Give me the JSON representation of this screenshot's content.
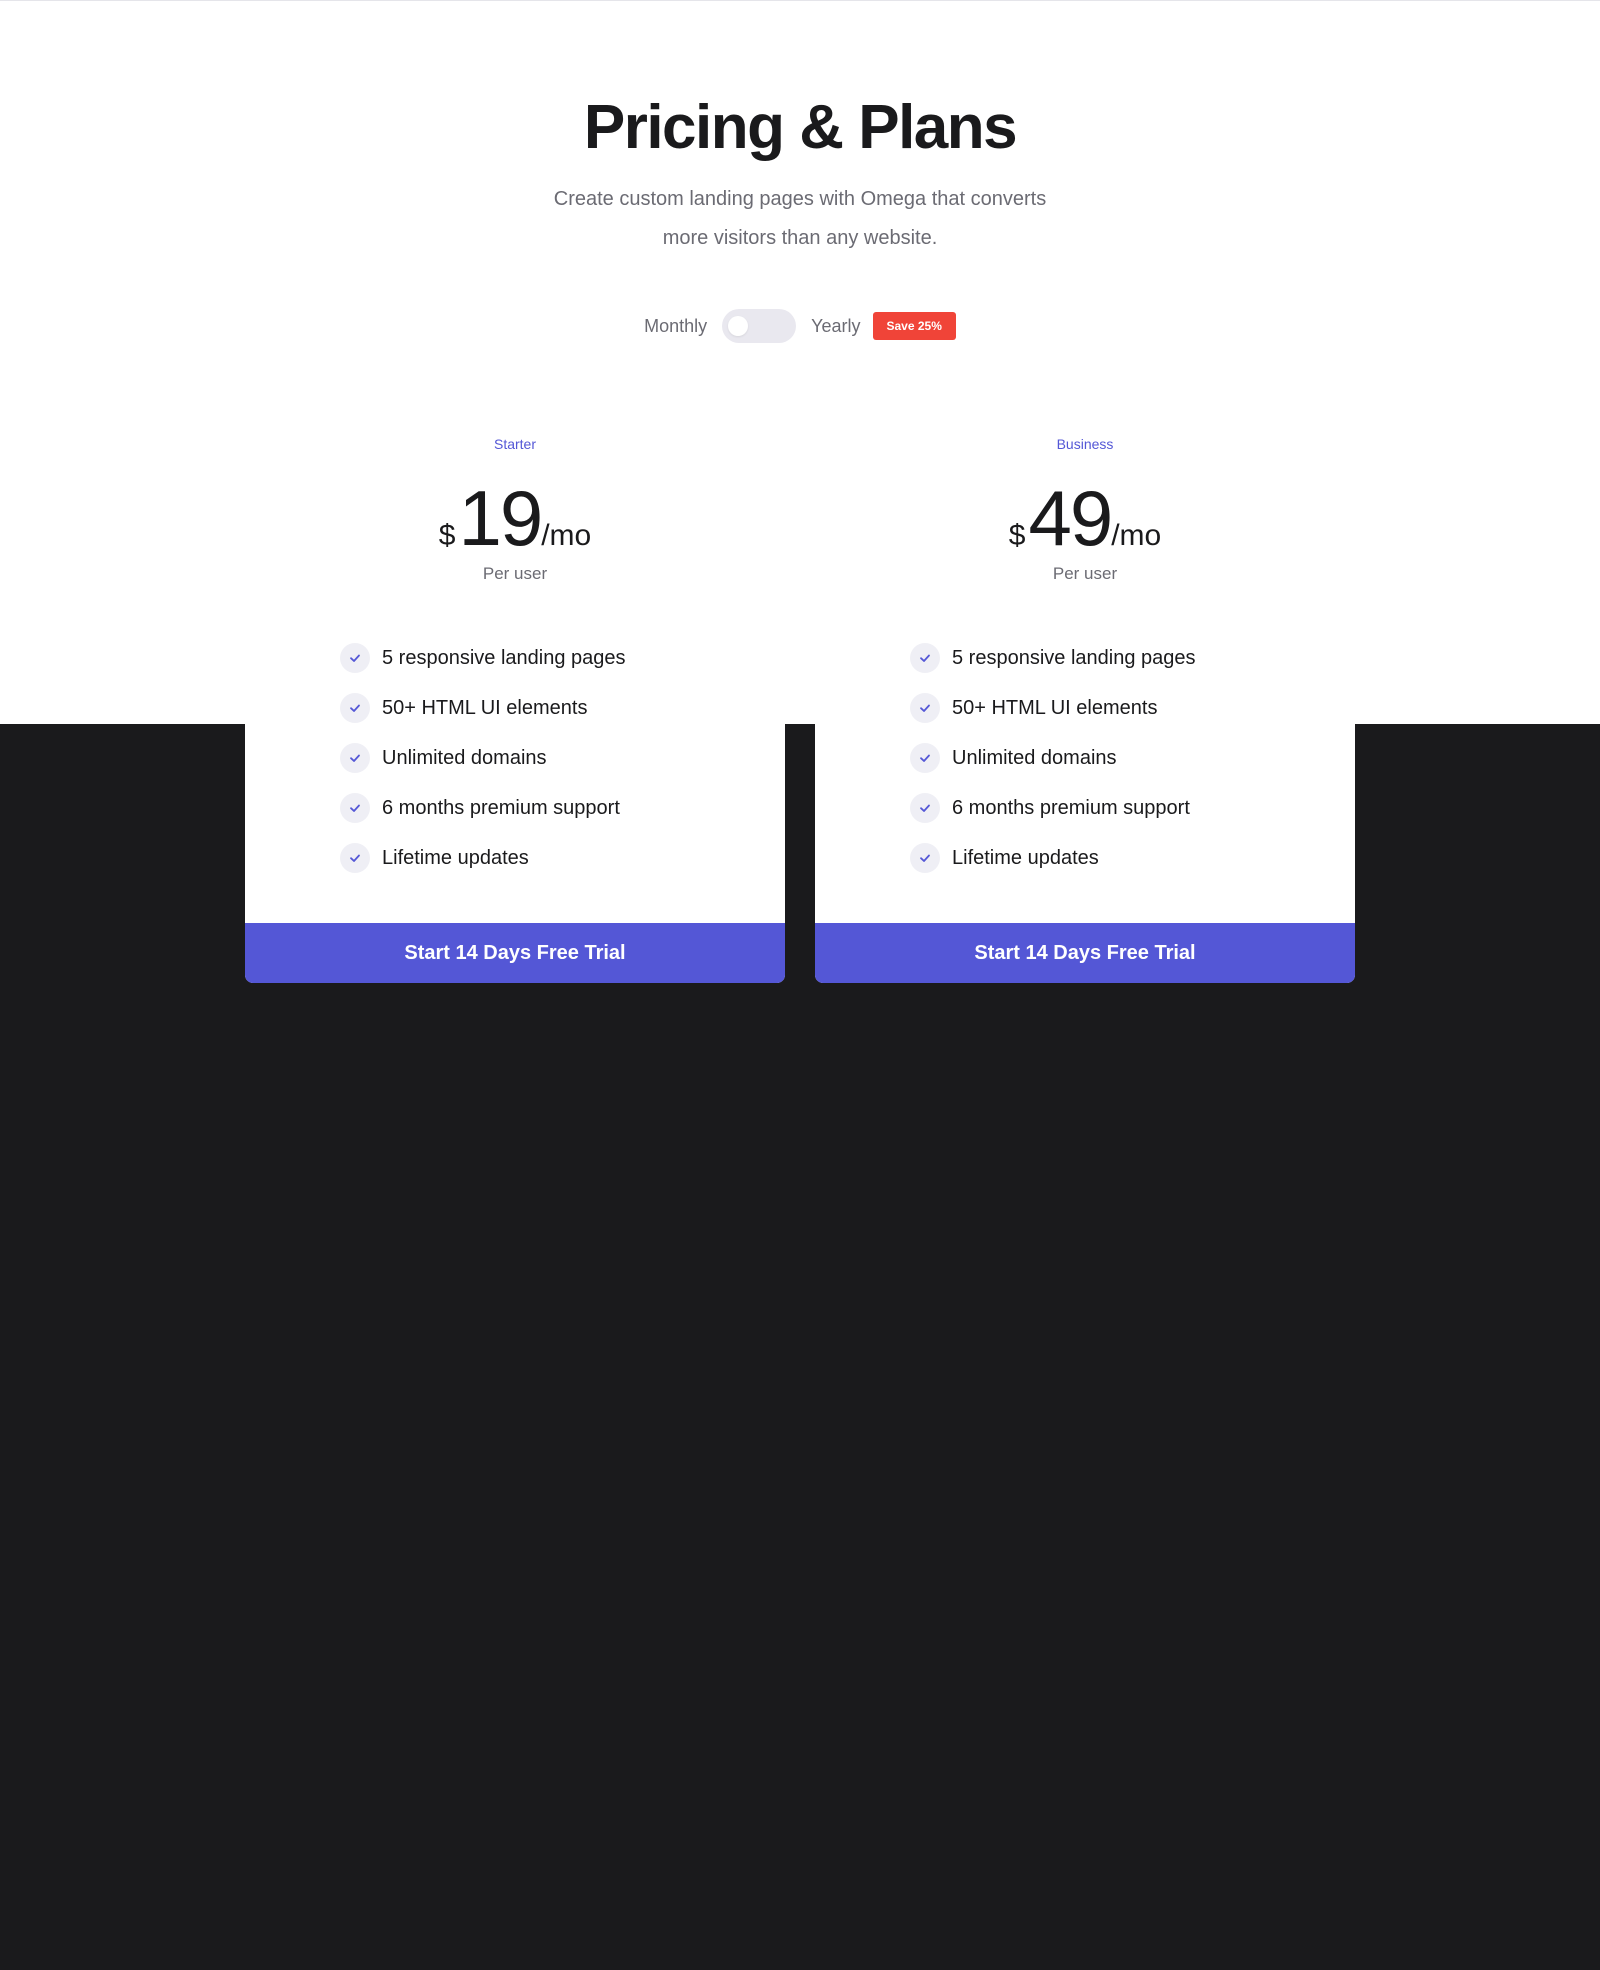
{
  "header": {
    "title": "Pricing & Plans",
    "subtitle_line1": "Create custom landing pages with Omega that converts",
    "subtitle_line2": "more visitors than any website."
  },
  "billing": {
    "monthly_label": "Monthly",
    "yearly_label": "Yearly",
    "save_badge": "Save 25%",
    "selected": "Monthly"
  },
  "plans": [
    {
      "name": "Starter",
      "currency": "$",
      "price": "19",
      "period": "/mo",
      "unit": "Per user",
      "features": [
        "5 responsive landing pages",
        "50+ HTML UI elements",
        "Unlimited domains",
        "6 months premium support",
        "Lifetime updates"
      ],
      "cta": "Start 14 Days Free Trial"
    },
    {
      "name": "Business",
      "currency": "$",
      "price": "49",
      "period": "/mo",
      "unit": "Per user",
      "features": [
        "5 responsive landing pages",
        "50+ HTML UI elements",
        "Unlimited domains",
        "6 months premium support",
        "Lifetime updates"
      ],
      "cta": "Start 14 Days Free Trial"
    }
  ],
  "colors": {
    "accent": "#5457d6",
    "badge": "#f04438",
    "dark_background": "#1a1a1c"
  }
}
